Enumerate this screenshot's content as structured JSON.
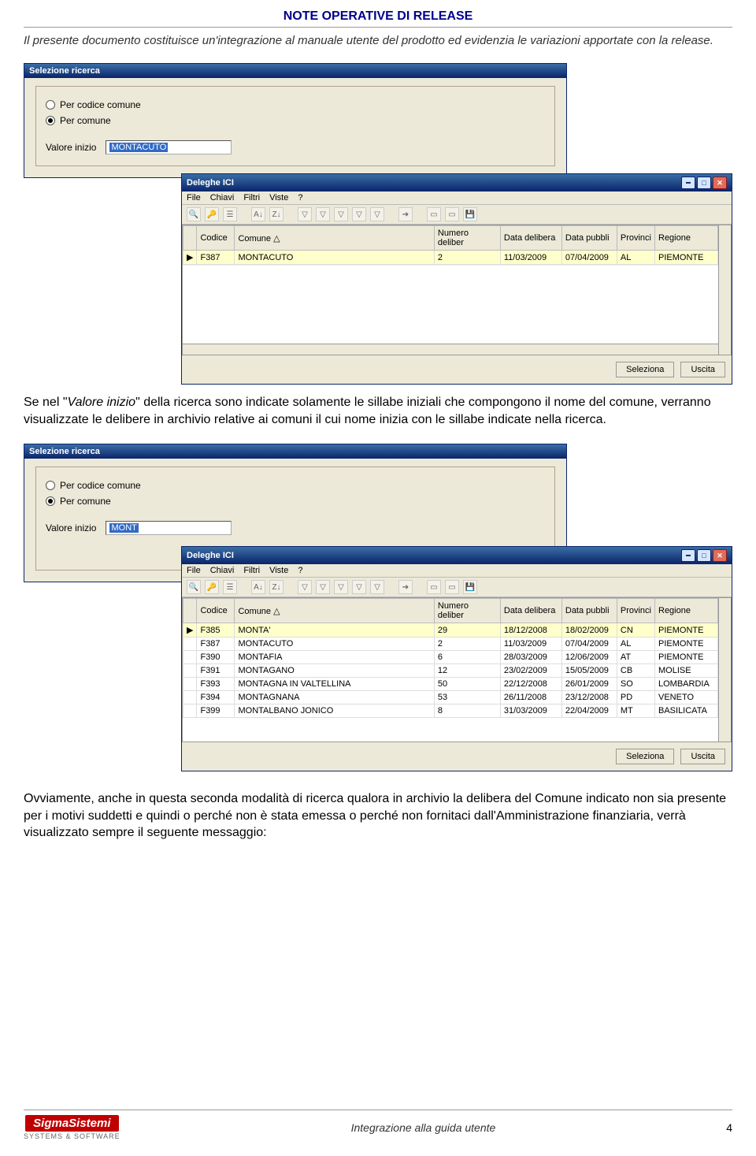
{
  "doc": {
    "title": "NOTE OPERATIVE DI RELEASE",
    "intro": "Il presente documento costituisce un'integrazione al manuale utente del prodotto ed evidenzia le variazioni apportate con la release.",
    "para1_a": "Se nel \"",
    "para1_i": "Valore inizio",
    "para1_b": "\" della ricerca sono indicate solamente le sillabe iniziali che compongono il nome del comune, verranno visualizzate le delibere in archivio relative ai comuni il cui nome inizia con le sillabe indicate nella ricerca.",
    "para2": "Ovviamente, anche in questa seconda modalità di ricerca qualora in archivio la delibera del Comune indicato non sia presente per i motivi suddetti e quindi o perché non è stata emessa o perché non fornitaci dall'Amministrazione finanziaria, verrà visualizzato sempre il seguente messaggio:",
    "footer_center": "Integrazione alla guida utente",
    "page_num": "4",
    "logo_top": "SigmaSistemi",
    "logo_bot": "SYSTEMS & SOFTWARE"
  },
  "sel1": {
    "title": "Selezione ricerca",
    "opt1": "Per codice comune",
    "opt2": "Per comune",
    "label": "Valore inizio",
    "value": "MONTACUTO"
  },
  "sel2": {
    "title": "Selezione ricerca",
    "opt1": "Per codice comune",
    "opt2": "Per comune",
    "label": "Valore inizio",
    "value": "MONT"
  },
  "del": {
    "title": "Deleghe ICI",
    "menu": {
      "file": "File",
      "chiavi": "Chiavi",
      "filtri": "Filtri",
      "viste": "Viste",
      "q": "?"
    },
    "cols": {
      "codice": "Codice",
      "comune": "Comune △",
      "num": "Numero deliber",
      "datadel": "Data delibera",
      "datapub": "Data pubbli",
      "prov": "Provinci",
      "reg": "Regione"
    },
    "row1": {
      "codice": "F387",
      "comune": "MONTACUTO",
      "num": "2",
      "datadel": "11/03/2009",
      "datapub": "07/04/2009",
      "prov": "AL",
      "reg": "PIEMONTE"
    },
    "rows2": [
      {
        "codice": "F385",
        "comune": "MONTA'",
        "num": "29",
        "datadel": "18/12/2008",
        "datapub": "18/02/2009",
        "prov": "CN",
        "reg": "PIEMONTE"
      },
      {
        "codice": "F387",
        "comune": "MONTACUTO",
        "num": "2",
        "datadel": "11/03/2009",
        "datapub": "07/04/2009",
        "prov": "AL",
        "reg": "PIEMONTE"
      },
      {
        "codice": "F390",
        "comune": "MONTAFIA",
        "num": "6",
        "datadel": "28/03/2009",
        "datapub": "12/06/2009",
        "prov": "AT",
        "reg": "PIEMONTE"
      },
      {
        "codice": "F391",
        "comune": "MONTAGANO",
        "num": "12",
        "datadel": "23/02/2009",
        "datapub": "15/05/2009",
        "prov": "CB",
        "reg": "MOLISE"
      },
      {
        "codice": "F393",
        "comune": "MONTAGNA IN VALTELLINA",
        "num": "50",
        "datadel": "22/12/2008",
        "datapub": "26/01/2009",
        "prov": "SO",
        "reg": "LOMBARDIA"
      },
      {
        "codice": "F394",
        "comune": "MONTAGNANA",
        "num": "53",
        "datadel": "26/11/2008",
        "datapub": "23/12/2008",
        "prov": "PD",
        "reg": "VENETO"
      },
      {
        "codice": "F399",
        "comune": "MONTALBANO JONICO",
        "num": "8",
        "datadel": "31/03/2009",
        "datapub": "22/04/2009",
        "prov": "MT",
        "reg": "BASILICATA"
      }
    ],
    "btn_sel": "Seleziona",
    "btn_exit": "Uscita"
  }
}
